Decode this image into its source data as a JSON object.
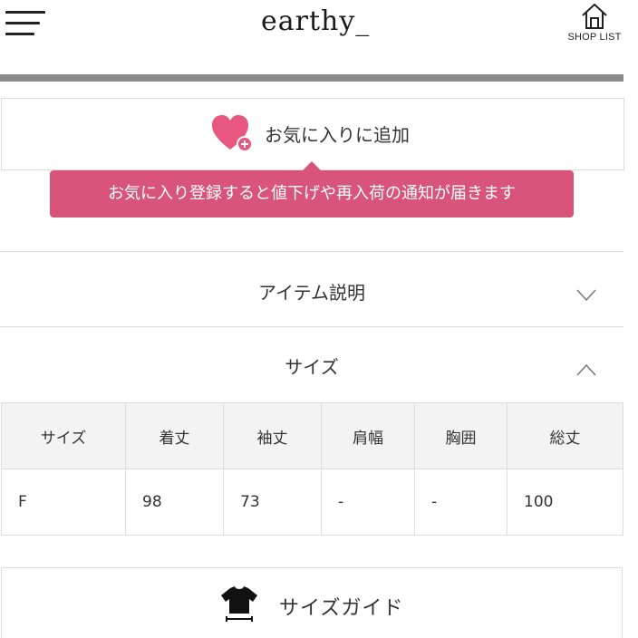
{
  "header": {
    "logo": "earthy_",
    "shop_list_label": "SHOP LIST",
    "menu_icon": "hamburger-menu-icon",
    "shop_icon": "house-icon"
  },
  "favorite": {
    "label": "お気に入りに追加",
    "icon": "heart-plus-icon",
    "tooltip": "お気に入り登録すると値下げや再入荷の通知が届きます",
    "accent_color": "#d9547a"
  },
  "accordion": {
    "item_description": "アイテム説明",
    "size": "サイズ"
  },
  "size_table": {
    "headers": [
      "サイズ",
      "着丈",
      "袖丈",
      "肩幅",
      "胸囲",
      "総丈"
    ],
    "rows": [
      [
        "F",
        "98",
        "73",
        "-",
        "-",
        "100"
      ]
    ]
  },
  "size_guide": {
    "label": "サイズガイド",
    "icon": "tshirt-measure-icon"
  }
}
